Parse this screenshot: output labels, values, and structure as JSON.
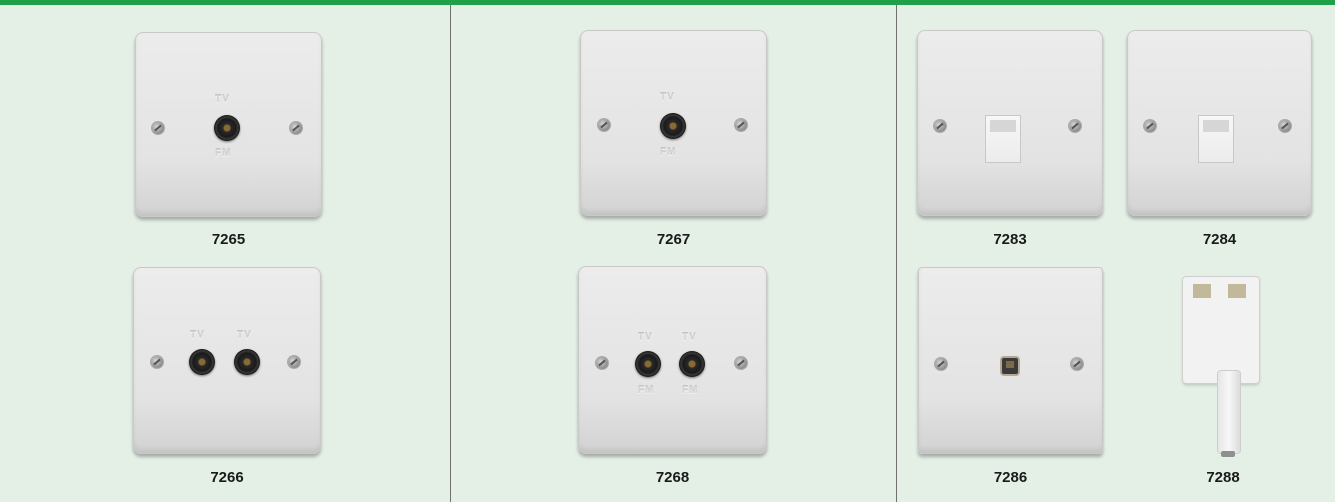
{
  "products": [
    {
      "code": "7265",
      "type": "single-coax-outlet",
      "labels": [
        "TV",
        "FM"
      ]
    },
    {
      "code": "7267",
      "type": "single-coax-outlet",
      "labels": [
        "TV",
        "FM"
      ]
    },
    {
      "code": "7283",
      "type": "data-outlet-rj45"
    },
    {
      "code": "7284",
      "type": "data-outlet-rj45"
    },
    {
      "code": "7266",
      "type": "twin-coax-outlet",
      "labels": [
        "TV",
        "TV"
      ]
    },
    {
      "code": "7268",
      "type": "twin-coax-outlet",
      "labels": [
        "TV",
        "TV",
        "FM",
        "FM"
      ]
    },
    {
      "code": "7286",
      "type": "telephone-outlet-rj11"
    },
    {
      "code": "7288",
      "type": "plug-adapter"
    }
  ],
  "colors": {
    "accent": "#1fa04a",
    "background": "#e4efe6",
    "divider": "#6f6f6f"
  }
}
